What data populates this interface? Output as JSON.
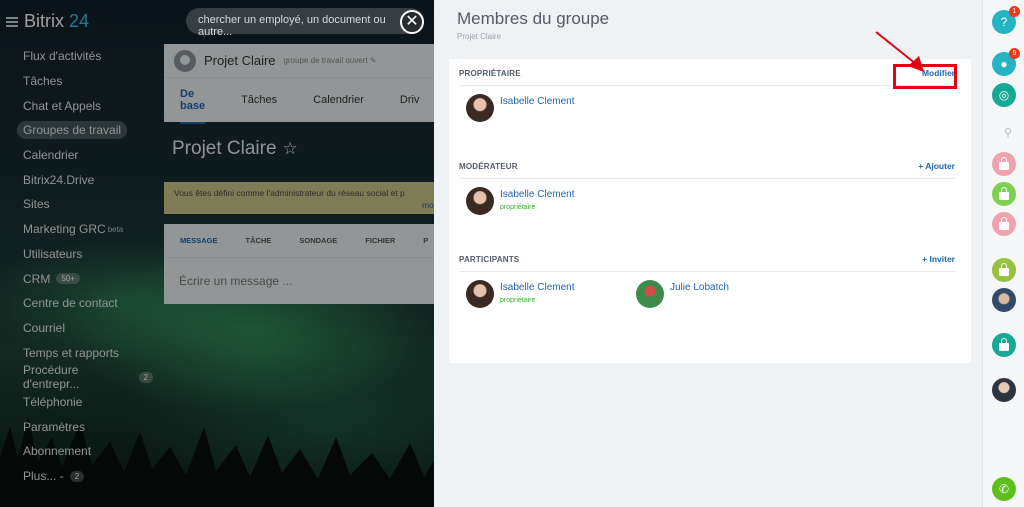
{
  "app": {
    "logo_text": "Bitrix",
    "logo_num": "24"
  },
  "search": {
    "placeholder": "chercher un employé, un document ou autre..."
  },
  "sidebar": {
    "items": [
      {
        "label": "Flux d'activités"
      },
      {
        "label": "Tâches"
      },
      {
        "label": "Chat et Appels"
      },
      {
        "label": "Groupes de travail"
      },
      {
        "label": "Calendrier"
      },
      {
        "label": "Bitrix24.Drive"
      },
      {
        "label": "Sites"
      },
      {
        "label": "Marketing GRC",
        "suffix": "beta"
      },
      {
        "label": "Utilisateurs"
      },
      {
        "label": "CRM",
        "badge": "50+"
      },
      {
        "label": "Centre de contact"
      },
      {
        "label": "Courriel"
      },
      {
        "label": "Temps et rapports"
      },
      {
        "label": "Procédure d'entrepr...",
        "badge": "2"
      },
      {
        "label": "Téléphonie"
      },
      {
        "label": "Paramètres"
      },
      {
        "label": "Abonnement"
      },
      {
        "label": "Plus... -",
        "badge": "2"
      }
    ]
  },
  "main": {
    "group_title": "Projet Claire",
    "group_sub": "groupe de travail ouvert ✎",
    "tabs": [
      "De base",
      "Tâches",
      "Calendrier",
      "Driv"
    ],
    "page_title": "Projet Claire",
    "notice": "Vous êtes défini comme l'administrateur du réseau social et p",
    "notice_more": "mo",
    "post_tabs": [
      "MESSAGE",
      "TÂCHE",
      "SONDAGE",
      "FICHIER",
      "P"
    ],
    "post_placeholder": "Écrire un message ..."
  },
  "panel": {
    "title": "Membres du groupe",
    "subtitle": "Projet Claire",
    "owner": {
      "label": "PROPRIÉTAIRE",
      "action": "Modifier",
      "members": [
        {
          "name": "Isabelle Clement"
        }
      ]
    },
    "moderator": {
      "label": "MODÉRATEUR",
      "action": "+ Ajouter",
      "members": [
        {
          "name": "Isabelle Clement",
          "role": "propriétaire"
        }
      ]
    },
    "participants": {
      "label": "PARTICIPANTS",
      "action": "+ Inviter",
      "members": [
        {
          "name": "Isabelle Clement",
          "role": "propriétaire"
        },
        {
          "name": "Julie Lobatch"
        }
      ]
    }
  },
  "rightbar": {
    "help_badge": "1",
    "notif_badge": "5",
    "help_icon": "?"
  },
  "colors": {
    "link": "#2067b0",
    "highlight": "#e20612",
    "role": "#3cb02c",
    "brand": "#2fc6f6"
  }
}
